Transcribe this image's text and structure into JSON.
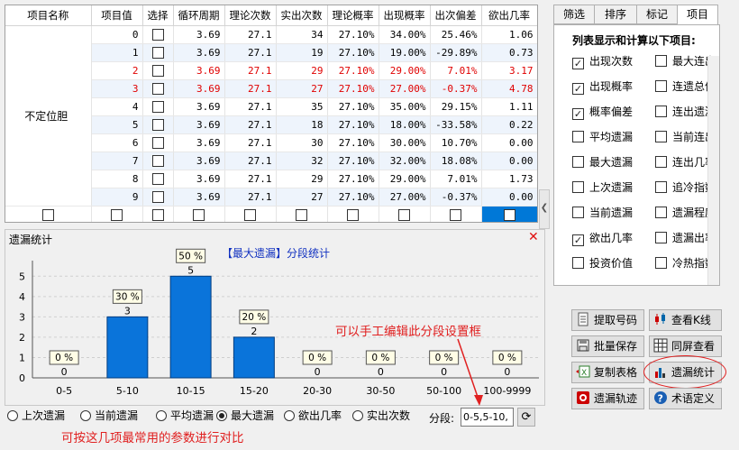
{
  "grid": {
    "headers": [
      "项目名称",
      "项目值",
      "选择",
      "循环周期",
      "理论次数",
      "实出次数",
      "理论概率",
      "出现概率",
      "出次偏差",
      "欲出几率"
    ],
    "group_name": "不定位胆",
    "rows": [
      {
        "value": "0",
        "checked": false,
        "cycle": "3.69",
        "theory": "27.1",
        "actual": "34",
        "tprob": "27.10%",
        "prob": "34.00%",
        "dev": "25.46%",
        "rate": "1.06",
        "red": false
      },
      {
        "value": "1",
        "checked": false,
        "cycle": "3.69",
        "theory": "27.1",
        "actual": "19",
        "tprob": "27.10%",
        "prob": "19.00%",
        "dev": "-29.89%",
        "rate": "0.73",
        "red": false
      },
      {
        "value": "2",
        "checked": false,
        "cycle": "3.69",
        "theory": "27.1",
        "actual": "29",
        "tprob": "27.10%",
        "prob": "29.00%",
        "dev": "7.01%",
        "rate": "3.17",
        "red": true
      },
      {
        "value": "3",
        "checked": false,
        "cycle": "3.69",
        "theory": "27.1",
        "actual": "27",
        "tprob": "27.10%",
        "prob": "27.00%",
        "dev": "-0.37%",
        "rate": "4.78",
        "red": true
      },
      {
        "value": "4",
        "checked": false,
        "cycle": "3.69",
        "theory": "27.1",
        "actual": "35",
        "tprob": "27.10%",
        "prob": "35.00%",
        "dev": "29.15%",
        "rate": "1.11",
        "red": false
      },
      {
        "value": "5",
        "checked": false,
        "cycle": "3.69",
        "theory": "27.1",
        "actual": "18",
        "tprob": "27.10%",
        "prob": "18.00%",
        "dev": "-33.58%",
        "rate": "0.22",
        "red": false
      },
      {
        "value": "6",
        "checked": false,
        "cycle": "3.69",
        "theory": "27.1",
        "actual": "30",
        "tprob": "27.10%",
        "prob": "30.00%",
        "dev": "10.70%",
        "rate": "0.00",
        "red": false
      },
      {
        "value": "7",
        "checked": false,
        "cycle": "3.69",
        "theory": "27.1",
        "actual": "32",
        "tprob": "27.10%",
        "prob": "32.00%",
        "dev": "18.08%",
        "rate": "0.00",
        "red": false
      },
      {
        "value": "8",
        "checked": false,
        "cycle": "3.69",
        "theory": "27.1",
        "actual": "29",
        "tprob": "27.10%",
        "prob": "29.00%",
        "dev": "7.01%",
        "rate": "1.73",
        "red": false
      },
      {
        "value": "9",
        "checked": false,
        "cycle": "3.69",
        "theory": "27.1",
        "actual": "27",
        "tprob": "27.10%",
        "prob": "27.00%",
        "dev": "-0.37%",
        "rate": "0.00",
        "red": false
      }
    ]
  },
  "panel": {
    "title": "遗漏统计",
    "close_glyph": "✕"
  },
  "chart_data": {
    "type": "bar",
    "title": "【最大遗漏】分段统计",
    "categories": [
      "0-5",
      "5-10",
      "10-15",
      "15-20",
      "20-30",
      "30-50",
      "50-100",
      "100-9999"
    ],
    "values": [
      0,
      3,
      5,
      2,
      0,
      0,
      0,
      0
    ],
    "percent_labels": [
      "0 %",
      "30 %",
      "50 %",
      "20 %",
      "0 %",
      "0 %",
      "0 %",
      "0 %"
    ],
    "ylim": [
      0,
      5.5
    ],
    "yticks": [
      0,
      1,
      2,
      3,
      4,
      5
    ],
    "bar_color": "#0a74da",
    "grid": true
  },
  "annotations": {
    "edit_hint": "可以手工编辑此分段设置框",
    "compare_hint": "可按这几项最常用的参数进行对比"
  },
  "radios": {
    "options": [
      {
        "label": "上次遗漏",
        "selected": false
      },
      {
        "label": "当前遗漏",
        "selected": false
      },
      {
        "label": "平均遗漏",
        "selected": false
      },
      {
        "label": "最大遗漏",
        "selected": true
      },
      {
        "label": "欲出几率",
        "selected": false
      },
      {
        "label": "实出次数",
        "selected": false
      }
    ],
    "segment_label": "分段:",
    "segment_value": "0-5,5-10,"
  },
  "tabs": [
    {
      "label": "筛选",
      "active": false
    },
    {
      "label": "排序",
      "active": false
    },
    {
      "label": "标记",
      "active": false
    },
    {
      "label": "项目",
      "active": true
    }
  ],
  "items_panel": {
    "header": "列表显示和计算以下项目:",
    "left": [
      {
        "label": "出现次数",
        "checked": true
      },
      {
        "label": "出现概率",
        "checked": true
      },
      {
        "label": "概率偏差",
        "checked": true
      },
      {
        "label": "平均遗漏",
        "checked": false
      },
      {
        "label": "最大遗漏",
        "checked": false
      },
      {
        "label": "上次遗漏",
        "checked": false
      },
      {
        "label": "当前遗漏",
        "checked": false
      },
      {
        "label": "欲出几率",
        "checked": true
      },
      {
        "label": "投资价值",
        "checked": false
      }
    ],
    "right": [
      {
        "label": "最大连出",
        "checked": false
      },
      {
        "label": "连遗总值",
        "checked": false
      },
      {
        "label": "连出遗漏",
        "checked": false
      },
      {
        "label": "当前连出",
        "checked": false
      },
      {
        "label": "连出几率",
        "checked": false
      },
      {
        "label": "追冷指数",
        "checked": false
      },
      {
        "label": "遗漏程度",
        "checked": false
      },
      {
        "label": "遗漏出率",
        "checked": false
      },
      {
        "label": "冷热指数",
        "checked": false
      }
    ]
  },
  "buttons": {
    "fetch": "提取号码",
    "k_line": "查看K线",
    "batch_save": "批量保存",
    "same_screen": "同屏查看",
    "copy_table": "复制表格",
    "miss_stats": "遗漏统计",
    "miss_track": "遗漏轨迹",
    "glossary": "术语定义"
  },
  "colors": {
    "accent": "#0078d7",
    "red_text": "#e00000",
    "annotation": "#e02020"
  }
}
